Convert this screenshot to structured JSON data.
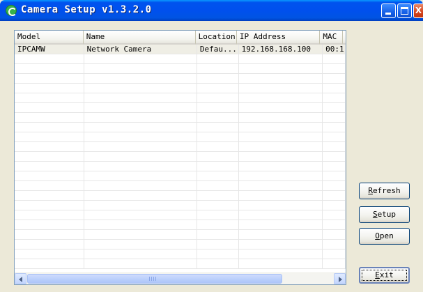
{
  "window": {
    "title": "Camera Setup v1.3.2.0",
    "controls": {
      "minimize": "minimize",
      "maximize": "maximize",
      "close": "X"
    }
  },
  "list": {
    "columns": [
      "Model",
      "Name",
      "Location",
      "IP Address",
      "MAC"
    ],
    "rows": [
      [
        "IPCAMW",
        "Network Camera",
        "Defau...",
        "192.168.168.100",
        "00:1"
      ]
    ],
    "empty_row_count": 22
  },
  "buttons": {
    "refresh": "Refresh",
    "refresh_accel": "R",
    "setup": "Setup",
    "setup_accel": "S",
    "open": "Open",
    "open_accel": "O",
    "exit": "Exit",
    "exit_accel": "E"
  },
  "colors": {
    "titlebar": "#0054e3",
    "face": "#ece9d8",
    "selected_row": "#efeee5",
    "scrollbar_thumb": "#b9cefb"
  },
  "icons": [
    "app-icon",
    "minimize-icon",
    "maximize-icon",
    "close-icon",
    "arrow-left-icon",
    "arrow-right-icon"
  ]
}
